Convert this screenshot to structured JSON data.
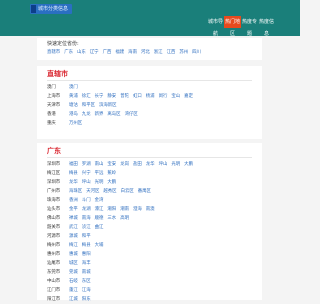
{
  "header": {
    "logo_text": "城市分类信息",
    "nav": [
      {
        "label": "城市导航",
        "active": false
      },
      {
        "label": "热门地区",
        "active": true
      },
      {
        "label": "热度专题",
        "active": false
      },
      {
        "label": "热度信息",
        "active": false
      }
    ]
  },
  "quick_select": {
    "title": "快速定位省份:",
    "provinces": [
      "直辖市",
      "广东",
      "山东",
      "辽宁",
      "广西",
      "福建",
      "海南",
      "河北",
      "浙江",
      "江西",
      "苏州",
      "四川"
    ]
  },
  "sections": [
    {
      "title": "直辖市",
      "rows": [
        {
          "city": "澳门",
          "districts": [
            "澳门"
          ]
        },
        {
          "city": "上海市",
          "districts": [
            "黄浦",
            "徐汇",
            "长宁",
            "静安",
            "普陀",
            "虹口",
            "杨浦",
            "闵行",
            "宝山",
            "嘉定"
          ]
        },
        {
          "city": "天津市",
          "districts": [
            "塘沽",
            "和平区",
            "滨海新区"
          ]
        },
        {
          "city": "香港",
          "districts": [
            "港岛",
            "九龙",
            "新界",
            "离岛区",
            "湾仔区"
          ]
        },
        {
          "city": "重庆",
          "districts": [
            "万州区"
          ]
        }
      ]
    },
    {
      "title": "广东",
      "rows": [
        {
          "city": "深圳市",
          "districts": [
            "福田",
            "罗湖",
            "南山",
            "宝安",
            "龙岗",
            "盐田",
            "龙华",
            "坪山",
            "光明",
            "大鹏"
          ]
        },
        {
          "city": "梅江区",
          "districts": [
            "梅县",
            "兴宁",
            "平远",
            "蕉岭"
          ]
        },
        {
          "city": "深圳市",
          "districts": [
            "龙华",
            "坪山",
            "光明",
            "大鹏"
          ]
        },
        {
          "city": "广州市",
          "districts": [
            "海珠区",
            "天河区",
            "越秀区",
            "白云区",
            "番禺区"
          ]
        },
        {
          "city": "珠海市",
          "districts": [
            "香洲",
            "斗门",
            "金湾"
          ]
        },
        {
          "city": "汕头市",
          "districts": [
            "金平",
            "龙湖",
            "濠江",
            "潮阳",
            "潮南",
            "澄海",
            "南澳"
          ]
        },
        {
          "city": "佛山市",
          "districts": [
            "禅城",
            "南海",
            "顺德",
            "三水",
            "高明"
          ]
        },
        {
          "city": "韶关市",
          "districts": [
            "武江",
            "浈江",
            "曲江"
          ]
        },
        {
          "city": "河源市",
          "districts": [
            "源城",
            "和平"
          ]
        },
        {
          "city": "梅州市",
          "districts": [
            "梅江",
            "梅县",
            "大埔"
          ]
        },
        {
          "city": "惠州市",
          "districts": [
            "惠城",
            "惠阳"
          ]
        },
        {
          "city": "汕尾市",
          "districts": [
            "城区",
            "海丰"
          ]
        },
        {
          "city": "东莞市",
          "districts": [
            "莞城",
            "南城"
          ]
        },
        {
          "city": "中山市",
          "districts": [
            "石岐",
            "东区"
          ]
        },
        {
          "city": "江门市",
          "districts": [
            "蓬江",
            "江海"
          ]
        },
        {
          "city": "阳江市",
          "districts": [
            "江城",
            "阳东"
          ]
        }
      ]
    }
  ]
}
